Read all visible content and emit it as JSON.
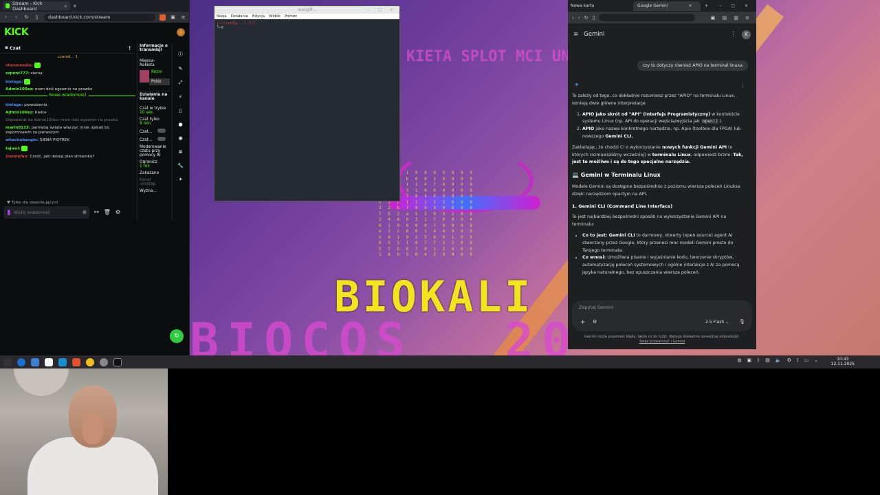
{
  "kick": {
    "tab_title": "Stream - Kick Dashboard",
    "new_tab_label": "+",
    "url": "dashboard.kick.com/stream",
    "logo": "KICK",
    "chat_title": "Czat",
    "pinned": "czared... 1",
    "messages": [
      {
        "user": "stormmedia:",
        "text": "",
        "cls": "u-red"
      },
      {
        "user": "szpont777:",
        "text": "siema",
        "cls": "u-green"
      },
      {
        "user": "bielaga:",
        "text": "",
        "cls": "u-blue"
      },
      {
        "user": "Admin100ez:",
        "text": "mam dziś egzamin na prawko",
        "cls": "u-green"
      }
    ],
    "new_messages": "Nowe wiadomości",
    "messages2": [
      {
        "user": "bielaga:",
        "text": "powodzenia",
        "cls": "u-blue"
      },
      {
        "user": "Admin100ez:",
        "text": "Kiełce",
        "cls": "u-green"
      },
      {
        "user": "",
        "text": "Odpowiedź do Admin100ez: mam dziś egzamin na prawko",
        "cls": ""
      },
      {
        "user": "marin0133:",
        "text": "pamiętaj świata włączyć mnie ujebali bo zapomniałem za pierwszym",
        "cls": "u-green"
      },
      {
        "user": "whachubangin:",
        "text": "SIEMA PIOTREK",
        "cls": "u-blue"
      },
      {
        "user": "tajwol:",
        "text": "",
        "cls": "u-green"
      },
      {
        "user": "Ziemiefan:",
        "text": "Cześć, jaki dzisiaj plan streamka?",
        "cls": "u-red"
      }
    ],
    "followers_only": "Tylko dla obserwujących",
    "send_placeholder": "Wyślij wiadomość",
    "side": {
      "info": "Informacje o transmisji",
      "stream_name": "Mięsna-Rakieta",
      "cat1": "Rozm",
      "cat2": "Polsk",
      "actions": "Działania na kanale",
      "slow": "Czat w trybie",
      "slow_val": "10 sek.",
      "only": "Czat tylko",
      "only_val": "8 min",
      "emote": "Czat...",
      "emote2": "Czat...",
      "mod": "Moderowanie czatu przy pomocy AI",
      "limit": "Ogranicz",
      "limit_val": "1 rok",
      "banned": "Zakazane",
      "raid": "Kanał udostęp",
      "show": "Wyzna..."
    }
  },
  "terminal": {
    "title": "root@ff...",
    "menu": [
      "Sesja",
      "Działania",
      "Edycja",
      "Widok",
      "Pomoc"
    ],
    "prompt": "┌──(root@...)-[~]"
  },
  "desktop": {
    "title_top": "KIETA SPLOT MCI UNDALNE MAA",
    "brand": "BIOKALI",
    "brand_low": "BIOCOS",
    "brand_low2": "20"
  },
  "gemini": {
    "tab_inactive": "Nowa karta",
    "tab_active": "Google Gemini",
    "app_title": "Gemini",
    "user_msg": "czy to dotyczy również APIO na terminal linuxa",
    "intro": "To zależy od tego, co dokładnie rozumiesz przez \"APIO\" na terminalu Linux. Istnieją dwie główne interpretacje:",
    "li1_b": "APIO jako skrót od \"API\" (Interfejs Programistyczny)",
    "li1": " w kontekście systemu Linux (np. API do operacji wejścia/wyjścia jak",
    "li1_code": "open()",
    "li2_b": "APIO",
    "li2": " jako nazwa konkretnego narzędzia, np. Apio (toolbox dla FPGA) lub nowszego",
    "li2_b2": "Gemini CLI.",
    "para2a": "Zakładając, że chodzi Ci o wykorzystanie ",
    "para2b": "nowych funkcji Gemini API",
    "para2c": " (o których rozmawialiśmy wcześniej) w ",
    "para2d": "terminalu Linux",
    "para2e": ", odpowiedź brzmi: ",
    "para2f": "Tak, jest to możliwe i są do tego specjalne narzędzia.",
    "h3": "💻 Gemini w Terminalu Linux",
    "para3": "Modele Gemini są dostępne bezpośrednio z poziomu wiersza poleceń Linuksa dzięki narzędziom opartym na API.",
    "h4": "1. Gemini CLI (Command Line Interface)",
    "para4": "To jest najbardziej bezpośredni sposób na wykorzystanie Gemini API na terminalu:",
    "b1_b": "Co to jest: Gemini CLI",
    "b1": " to darmowy, otwarty (open-source) agent AI stworzony przez Google, który przenosi moc modeli Gemini prosto do Twojego terminala.",
    "b2_b": "Co wnosi:",
    "b2": " Umożliwia pisanie i wyjaśnianie kodu, tworzenie skryptów, automatyzację poleceń systemowych i ogólne interakcje z AI za pomocą języka naturalnego, bez opuszczania wiersza poleceń.",
    "input_placeholder": "Zapytaj Gemini",
    "model": "2.5 Flash",
    "footer1": "Gemini może popełniać błędy, także co do ludzi, dlatego dokładnie sprawdzaj odpowiedzi.",
    "footer2": "Twoja prywatność i Gemini"
  },
  "taskbar": {
    "time": "10:43",
    "date": "12.11.2025"
  }
}
